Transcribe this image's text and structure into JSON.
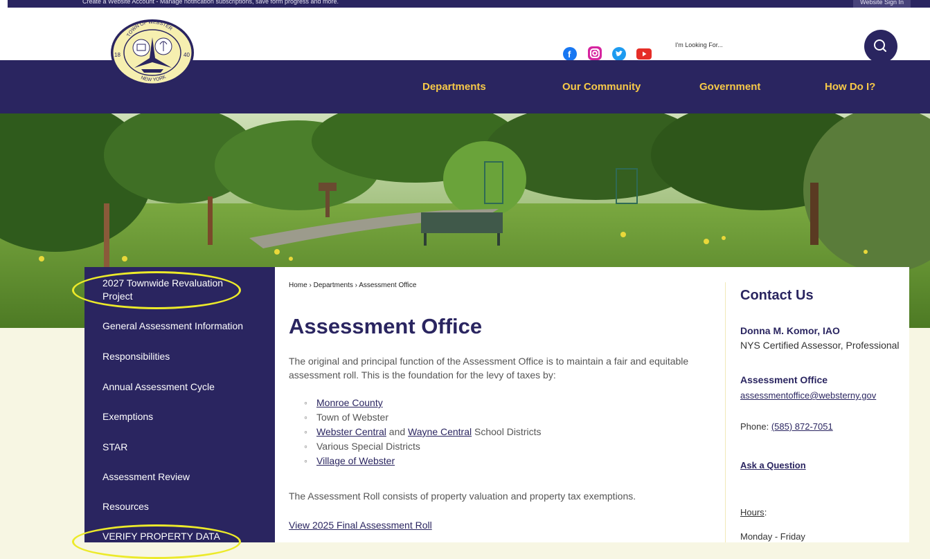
{
  "topbar": {
    "message": "Create a Website Account - Manage notification subscriptions, save form progress and more.",
    "signin_label": "Website Sign In"
  },
  "header": {
    "logo": {
      "top_text": "TOWN OF WEBSTER",
      "bottom_text": "NEW YORK",
      "left_num": "18",
      "right_num": "40"
    },
    "social_icons": [
      "facebook-icon",
      "instagram-icon",
      "twitter-icon",
      "youtube-icon"
    ],
    "search_placeholder": "I'm Looking For..."
  },
  "nav": {
    "items": [
      "Departments",
      "Our Community",
      "Government",
      "How Do I?"
    ]
  },
  "sidebar": {
    "items": [
      "2027 Townwide Revaluation Project",
      "General Assessment Information",
      "Responsibilities",
      "Annual Assessment Cycle",
      "Exemptions",
      "STAR",
      "Assessment Review",
      "Resources",
      "VERIFY PROPERTY DATA"
    ]
  },
  "breadcrumb": {
    "home": "Home",
    "sep": "›",
    "departments": "Departments",
    "current": "Assessment Office"
  },
  "main": {
    "title": "Assessment Office",
    "intro": "The original and principal function of the Assessment Office is to maintain a fair and equitable assessment roll. This is the foundation for the levy of taxes by:",
    "bullets": {
      "b1": "Monroe County",
      "b2": "Town of Webster",
      "b3_link1": "Webster Central",
      "b3_and": " and ",
      "b3_link2": "Wayne Central",
      "b3_rest": " School Districts",
      "b4": "Various Special Districts",
      "b5": "Village of Webster"
    },
    "roll_text": "The Assessment Roll consists of property valuation and property tax exemptions.",
    "roll_link": "View 2025 Final Assessment Roll"
  },
  "contact": {
    "title": "Contact Us",
    "name": "Donna M. Komor, IAO",
    "subtitle": "NYS Certified Assessor, Professional",
    "office": "Assessment Office",
    "email": "assessmentoffice@websterny.gov",
    "phone_label": "Phone: ",
    "phone": "(585) 872-7051",
    "ask": "Ask a Question",
    "hours_label": "Hours",
    "hours_colon": ":",
    "days": "Monday - Friday"
  },
  "colors": {
    "navy": "#2a2560",
    "gold": "#f7c948",
    "highlight": "#ecea2a",
    "cream": "#f7f6e3"
  }
}
